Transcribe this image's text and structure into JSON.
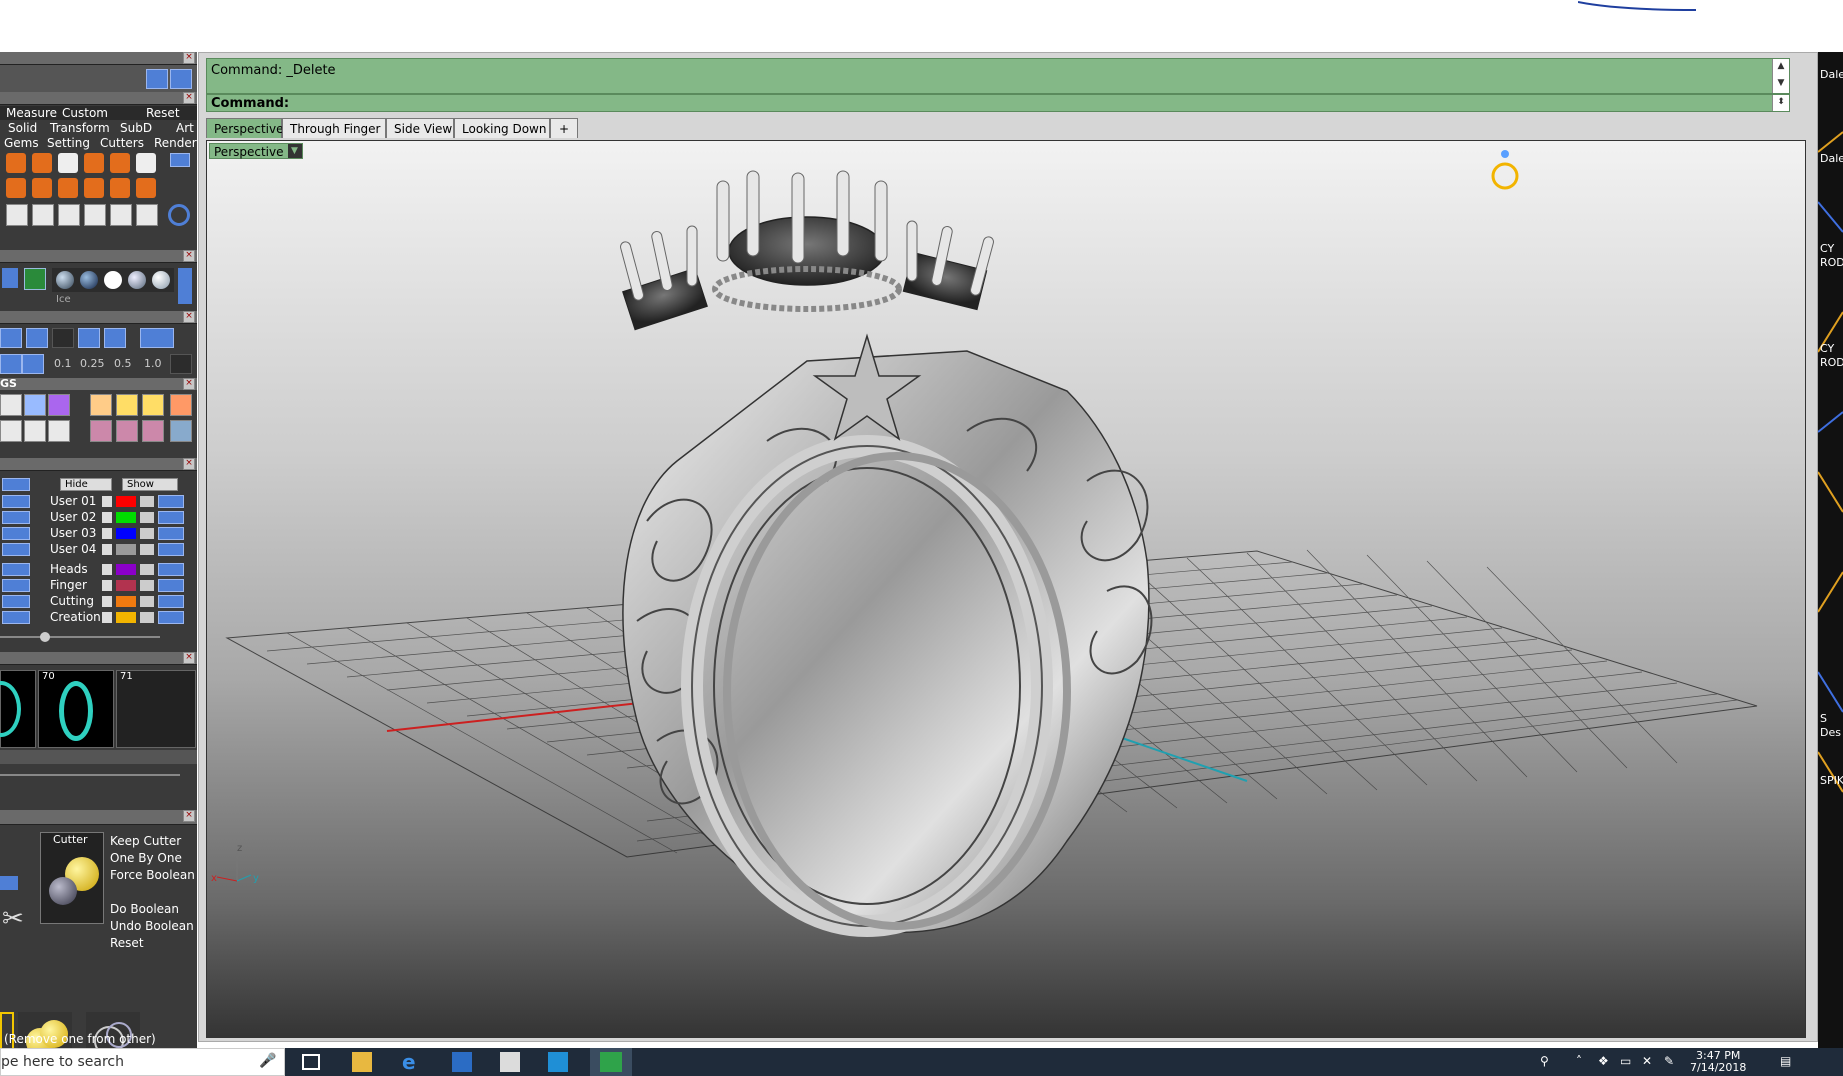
{
  "command": {
    "history": "Command: _Delete",
    "prompt": "Command:"
  },
  "viewport_tabs": [
    "Perspective",
    "Through Finger",
    "Side View",
    "Looking Down"
  ],
  "active_viewport_label": "Perspective",
  "left_panel": {
    "menu_row": [
      "Measure",
      "Custom",
      "Reset"
    ],
    "category_row1": [
      "Solid",
      "Transform",
      "SubD",
      "Art"
    ],
    "category_row2": [
      "Gems",
      "Setting",
      "Cutters",
      "Render"
    ],
    "material_label": "Ice",
    "snap_values": [
      "0.1",
      "0.25",
      "0.5",
      "1.0"
    ],
    "section_label": "GS",
    "hide_label": "Hide",
    "show_label": "Show",
    "layers": [
      {
        "name": "User 01",
        "color": "#ff0000"
      },
      {
        "name": "User 02",
        "color": "#00dd00"
      },
      {
        "name": "User 03",
        "color": "#0000ff"
      },
      {
        "name": "User 04",
        "color": "#9a9a9a"
      },
      {
        "name": "Heads",
        "color": "#8b00c9"
      },
      {
        "name": "Finger",
        "color": "#b2334f"
      },
      {
        "name": "Cutting",
        "color": "#f07a10"
      },
      {
        "name": "Creation",
        "color": "#f2b400"
      }
    ],
    "history_frames": [
      "70",
      "71"
    ],
    "cutter_label": "Cutter",
    "boolean_options": [
      "Keep Cutter",
      "One By One",
      "Force Boolean"
    ],
    "boolean_actions": [
      "Do Boolean",
      "Undo Boolean",
      "Reset"
    ],
    "status_hint": "(Remove one from other)"
  },
  "right_strip_labels": [
    "Dale",
    "Dale",
    "CY",
    "ROD",
    "CY",
    "ROD",
    "S",
    "Des",
    "SPIK"
  ],
  "taskbar": {
    "search_placeholder": "pe here to search",
    "time": "3:47 PM",
    "date": "7/14/2018"
  },
  "colors": {
    "command_green": "#84b887",
    "panel_blue": "#4f7fd6",
    "axis_x": "#cc2020",
    "axis_y": "#20a0b0"
  }
}
